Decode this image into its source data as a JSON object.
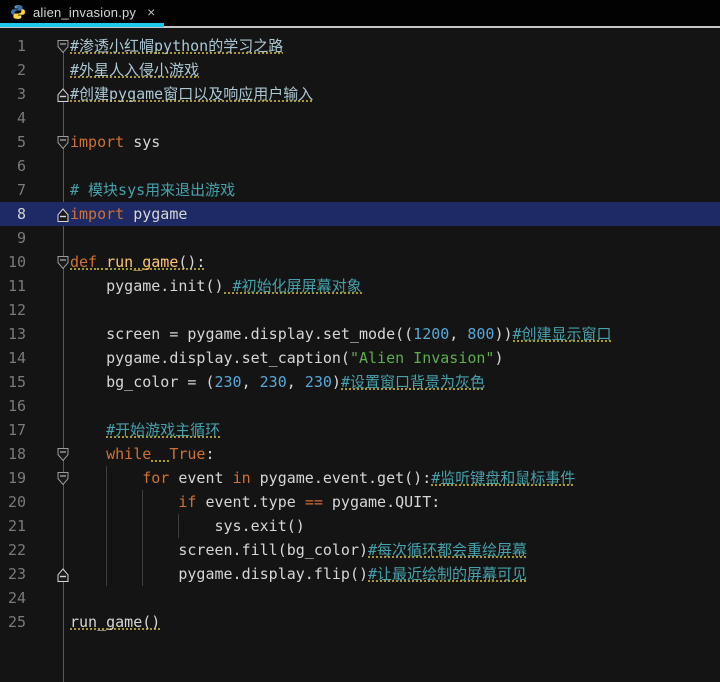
{
  "tab": {
    "title": "alien_invasion.py",
    "close_glyph": "×",
    "icon": "python-icon",
    "active_indicator_color": "#1cc8ea"
  },
  "colors": {
    "editor_background": "#141414",
    "tabbar_background": "#020202",
    "current_line": "#1e2a66",
    "keyword": "#cf7134",
    "function_name": "#ffc66d",
    "string": "#5dae4d",
    "number": "#58a8d8",
    "comment_teal": "#45a1ab",
    "comment_light": "#abc8d4",
    "plain_text": "#d6d6d6",
    "typo_underline": "#a89a24",
    "line_number": "#7a7a7a"
  },
  "editor": {
    "lines": [
      {
        "num": "1",
        "fold": "down",
        "tokens": [
          {
            "s": "#渗透小红帽python的学习之路",
            "c": "cl",
            "u": true
          }
        ]
      },
      {
        "num": "2",
        "tokens": [
          {
            "s": "#外星人入侵小游戏",
            "c": "cl",
            "u": true
          }
        ]
      },
      {
        "num": "3",
        "fold": "up",
        "tokens": [
          {
            "s": "#创建pygame窗口以及响应用户输入",
            "c": "cl",
            "u": true
          }
        ]
      },
      {
        "num": "4",
        "tokens": []
      },
      {
        "num": "5",
        "fold": "down",
        "tokens": [
          {
            "s": "import",
            "c": "kw"
          },
          {
            "s": " sys",
            "c": "pl"
          }
        ]
      },
      {
        "num": "6",
        "tokens": []
      },
      {
        "num": "7",
        "tokens": [
          {
            "s": "# 模块sys用来退出游戏",
            "c": "cm"
          }
        ]
      },
      {
        "num": "8",
        "fold": "up",
        "current": true,
        "tokens": [
          {
            "s": "import",
            "c": "kw"
          },
          {
            "s": " pygame",
            "c": "pl"
          }
        ]
      },
      {
        "num": "9",
        "tokens": []
      },
      {
        "num": "10",
        "fold": "down",
        "tokens": [
          {
            "s": "def",
            "c": "kw",
            "u": true
          },
          {
            "s": " ",
            "c": "pl",
            "u": true
          },
          {
            "s": "run_game",
            "c": "fn",
            "u": true
          },
          {
            "s": "():",
            "c": "pl",
            "u": true
          }
        ]
      },
      {
        "num": "11",
        "tokens": [
          {
            "s": "    pygame.init()",
            "c": "pl"
          },
          {
            "s": " #初始化屏屏幕对象",
            "c": "cm",
            "u": true
          }
        ]
      },
      {
        "num": "12",
        "tokens": []
      },
      {
        "num": "13",
        "tokens": [
          {
            "s": "    screen = pygame.display.set_mode((",
            "c": "pl"
          },
          {
            "s": "1200",
            "c": "num"
          },
          {
            "s": ", ",
            "c": "pl"
          },
          {
            "s": "800",
            "c": "num"
          },
          {
            "s": "))",
            "c": "pl"
          },
          {
            "s": "#创建显示窗口",
            "c": "cm",
            "u": true
          }
        ]
      },
      {
        "num": "14",
        "tokens": [
          {
            "s": "    pygame.display.set_caption(",
            "c": "pl"
          },
          {
            "s": "\"Alien Invasion\"",
            "c": "str"
          },
          {
            "s": ")",
            "c": "pl"
          }
        ]
      },
      {
        "num": "15",
        "tokens": [
          {
            "s": "    bg_color = (",
            "c": "pl"
          },
          {
            "s": "230",
            "c": "num"
          },
          {
            "s": ", ",
            "c": "pl"
          },
          {
            "s": "230",
            "c": "num"
          },
          {
            "s": ", ",
            "c": "pl"
          },
          {
            "s": "230",
            "c": "num"
          },
          {
            "s": ")",
            "c": "pl"
          },
          {
            "s": "#设置窗口背景为灰色",
            "c": "cm",
            "u": true
          }
        ]
      },
      {
        "num": "16",
        "tokens": []
      },
      {
        "num": "17",
        "tokens": [
          {
            "s": "    ",
            "c": "pl"
          },
          {
            "s": "#开始游戏主循环",
            "c": "cm",
            "u": true
          }
        ]
      },
      {
        "num": "18",
        "fold": "down",
        "tokens": [
          {
            "s": "    ",
            "c": "pl"
          },
          {
            "s": "while",
            "c": "kw"
          },
          {
            "s": "  ",
            "c": "pl",
            "u": true
          },
          {
            "s": "True",
            "c": "kw"
          },
          {
            "s": ":",
            "c": "pl"
          }
        ]
      },
      {
        "num": "19",
        "fold": "down",
        "guides": [
          4
        ],
        "tokens": [
          {
            "s": "        ",
            "c": "pl"
          },
          {
            "s": "for",
            "c": "kw"
          },
          {
            "s": " event ",
            "c": "pl"
          },
          {
            "s": "in",
            "c": "kw"
          },
          {
            "s": " pygame.event.get():",
            "c": "pl"
          },
          {
            "s": "#监听键盘和鼠标事件",
            "c": "cm",
            "u": true
          }
        ]
      },
      {
        "num": "20",
        "guides": [
          4,
          8
        ],
        "tokens": [
          {
            "s": "            ",
            "c": "pl"
          },
          {
            "s": "if",
            "c": "kw"
          },
          {
            "s": " event.type ",
            "c": "pl"
          },
          {
            "s": "==",
            "c": "kw"
          },
          {
            "s": " pygame.QUIT:",
            "c": "pl"
          }
        ]
      },
      {
        "num": "21",
        "guides": [
          4,
          8,
          12
        ],
        "tokens": [
          {
            "s": "                sys.exit()",
            "c": "pl"
          }
        ]
      },
      {
        "num": "22",
        "guides": [
          4,
          8
        ],
        "tokens": [
          {
            "s": "            screen.fill(bg_color)",
            "c": "pl"
          },
          {
            "s": "#每次循环都会重绘屏幕",
            "c": "cm",
            "u": true
          }
        ]
      },
      {
        "num": "23",
        "fold": "up",
        "guides": [
          4,
          8
        ],
        "tokens": [
          {
            "s": "            pygame.display.flip()",
            "c": "pl"
          },
          {
            "s": "#让最近绘制的屏幕可见",
            "c": "cm",
            "u": true
          }
        ]
      },
      {
        "num": "24",
        "tokens": []
      },
      {
        "num": "25",
        "tokens": [
          {
            "s": "run_game()",
            "c": "pl",
            "u": true
          }
        ]
      }
    ]
  }
}
